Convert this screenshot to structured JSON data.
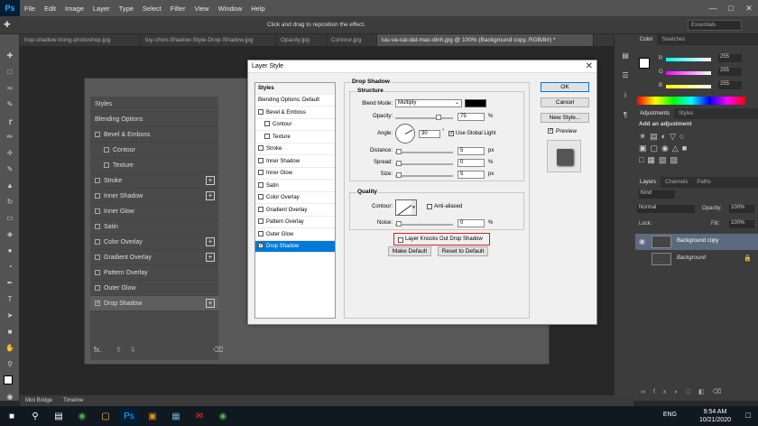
{
  "app": {
    "logo": "Ps"
  },
  "menu": [
    "File",
    "Edit",
    "Image",
    "Layer",
    "Type",
    "Select",
    "Filter",
    "View",
    "Window",
    "Help"
  ],
  "options_bar": {
    "hint": "Click and drag to reposition the effect.",
    "workspace": "Essentials"
  },
  "tabs": [
    {
      "label": "lrop-shadow-trong-photoshop.jpg",
      "active": false
    },
    {
      "label": "tuy-chon-Shadow-Style-Drop-Shadow.jpg",
      "active": false
    },
    {
      "label": "Opacity.jpg",
      "active": false
    },
    {
      "label": "Contour.jpg",
      "active": false
    },
    {
      "label": "luu-va-cai-dat-mac-dinh.jpg @ 100% (Background copy, RGB/8#) *",
      "active": true
    }
  ],
  "bg_dialog": {
    "items": [
      {
        "label": "Styles",
        "check": false,
        "plus": false
      },
      {
        "label": "Blending Options",
        "check": false,
        "plus": false
      },
      {
        "label": "Bevel & Emboss",
        "check": true,
        "plus": false
      },
      {
        "label": "Contour",
        "check": true,
        "plus": false,
        "indent": true
      },
      {
        "label": "Texture",
        "check": true,
        "plus": false,
        "indent": true
      },
      {
        "label": "Stroke",
        "check": true,
        "plus": true
      },
      {
        "label": "Inner Shadow",
        "check": true,
        "plus": true
      },
      {
        "label": "Inner Glow",
        "check": true,
        "plus": false
      },
      {
        "label": "Satin",
        "check": true,
        "plus": false
      },
      {
        "label": "Color Overlay",
        "check": true,
        "plus": true
      },
      {
        "label": "Gradient Overlay",
        "check": true,
        "plus": true
      },
      {
        "label": "Pattern Overlay",
        "check": true,
        "plus": false
      },
      {
        "label": "Outer Glow",
        "check": true,
        "plus": false
      },
      {
        "label": "Drop Shadow",
        "check": true,
        "plus": true,
        "checked": true
      }
    ]
  },
  "dialog": {
    "title": "Layer Style",
    "styles_header": "Styles",
    "style_items": [
      {
        "label": "Blending Options: Default",
        "cb": false
      },
      {
        "label": "Bevel & Emboss",
        "cb": true
      },
      {
        "label": "Contour",
        "cb": true,
        "indent": true
      },
      {
        "label": "Texture",
        "cb": true,
        "indent": true
      },
      {
        "label": "Stroke",
        "cb": true
      },
      {
        "label": "Inner Shadow",
        "cb": true
      },
      {
        "label": "Inner Glow",
        "cb": true
      },
      {
        "label": "Satin",
        "cb": true
      },
      {
        "label": "Color Overlay",
        "cb": true
      },
      {
        "label": "Gradient Overlay",
        "cb": true
      },
      {
        "label": "Pattern Overlay",
        "cb": true
      },
      {
        "label": "Outer Glow",
        "cb": true
      },
      {
        "label": "Drop Shadow",
        "cb": true,
        "checked": true,
        "selected": true
      }
    ],
    "section_title": "Drop Shadow",
    "structure_label": "Structure",
    "blend_mode_label": "Blend Mode:",
    "blend_mode_value": "Multiply",
    "shadow_color": "#000000",
    "opacity_label": "Opacity:",
    "opacity_value": "75",
    "opacity": 75,
    "angle_label": "Angle:",
    "angle_value": "30",
    "angle_unit": "°",
    "global_light_label": "Use Global Light",
    "distance_label": "Distance:",
    "distance_value": "5",
    "spread_label": "Spread:",
    "spread_value": "0",
    "size_label": "Size:",
    "size_value": "5",
    "quality_label": "Quality",
    "contour_label": "Contour:",
    "antialiased_label": "Anti-aliased",
    "noise_label": "Noise:",
    "noise_value": "0",
    "knockout_label": "Layer Knocks Out Drop Shadow",
    "make_default_label": "Make Default",
    "reset_default_label": "Reset to Default",
    "ok_label": "OK",
    "cancel_label": "Cancel",
    "new_style_label": "New Style...",
    "preview_label": "Preview",
    "unit_percent": "%",
    "unit_px": "px"
  },
  "right_panels": {
    "color_tabs": [
      "Color",
      "Swatches"
    ],
    "rgb_labels": [
      "R",
      "G",
      "B"
    ],
    "rgb_values": [
      "255",
      "255",
      "255"
    ],
    "adj_tabs": [
      "Adjustments",
      "Styles"
    ],
    "adj_title": "Add an adjustment",
    "layers_tabs": [
      "Layers",
      "Channels",
      "Paths"
    ],
    "kind_label": "Kind",
    "blend": "Normal",
    "opacity_label": "Opacity:",
    "opacity_value": "100%",
    "lock_label": "Lock:",
    "fill_label": "Fill:",
    "fill_value": "100%",
    "layers": [
      {
        "name": "Background copy",
        "selected": true
      },
      {
        "name": "Background",
        "selected": false
      }
    ]
  },
  "bottom_tabs": [
    "Mini Bridge",
    "Timeline"
  ],
  "taskbar": {
    "time": "9:54 AM",
    "date": "10/21/2020",
    "lang": "ENG"
  },
  "colors": {
    "accent": "#0078d7",
    "highlight": "#e02020",
    "ps_blue": "#31a8ff"
  }
}
